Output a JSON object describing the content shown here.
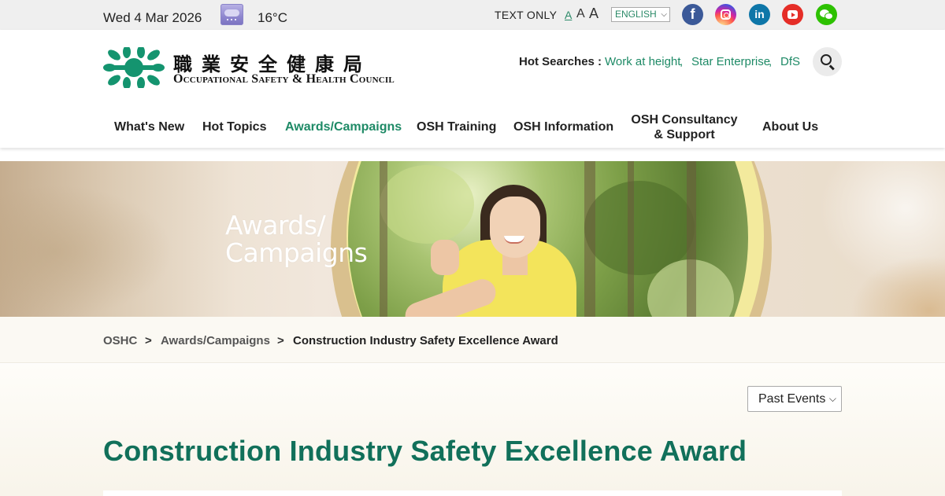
{
  "topbar": {
    "date": "Wed 4 Mar 2026",
    "weather_icon": "cloudy-rain-icon",
    "temperature": "16°C",
    "text_only": "TEXT ONLY",
    "font_sizes": [
      "A",
      "A",
      "A"
    ],
    "language": "ENGLISH",
    "social": [
      {
        "name": "facebook-icon",
        "glyph": "f",
        "color": "#3b5998"
      },
      {
        "name": "instagram-icon",
        "glyph": "",
        "color": "#d6249f"
      },
      {
        "name": "linkedin-icon",
        "glyph": "in",
        "color": "#0e76a8"
      },
      {
        "name": "youtube-icon",
        "glyph": "",
        "color": "#e52d27"
      },
      {
        "name": "wechat-icon",
        "glyph": "",
        "color": "#2dc100"
      }
    ]
  },
  "header": {
    "logo_zh": "職業安全健康局",
    "logo_en": "Occupational Safety & Health Council",
    "hot_searches_label": "Hot Searches :",
    "hot_searches": [
      "Work at height",
      "Star Enterprise",
      "DfS"
    ],
    "brand_color": "#1e8a66"
  },
  "nav": {
    "items": [
      "What's New",
      "Hot Topics",
      "Awards/Campaigns",
      "OSH Training",
      "OSH Information",
      "OSH Consultancy",
      "& Support",
      "About Us"
    ],
    "active": "Awards/Campaigns"
  },
  "banner": {
    "title_line1": "Awards/",
    "title_line2": "Campaigns"
  },
  "breadcrumb": {
    "items": [
      "OSHC",
      "Awards/Campaigns",
      "Construction Industry Safety Excellence Award"
    ],
    "separator": ">"
  },
  "content": {
    "events_filter": "Past Events",
    "title": "Construction Industry Safety Excellence Award",
    "title_color": "#11705a"
  }
}
